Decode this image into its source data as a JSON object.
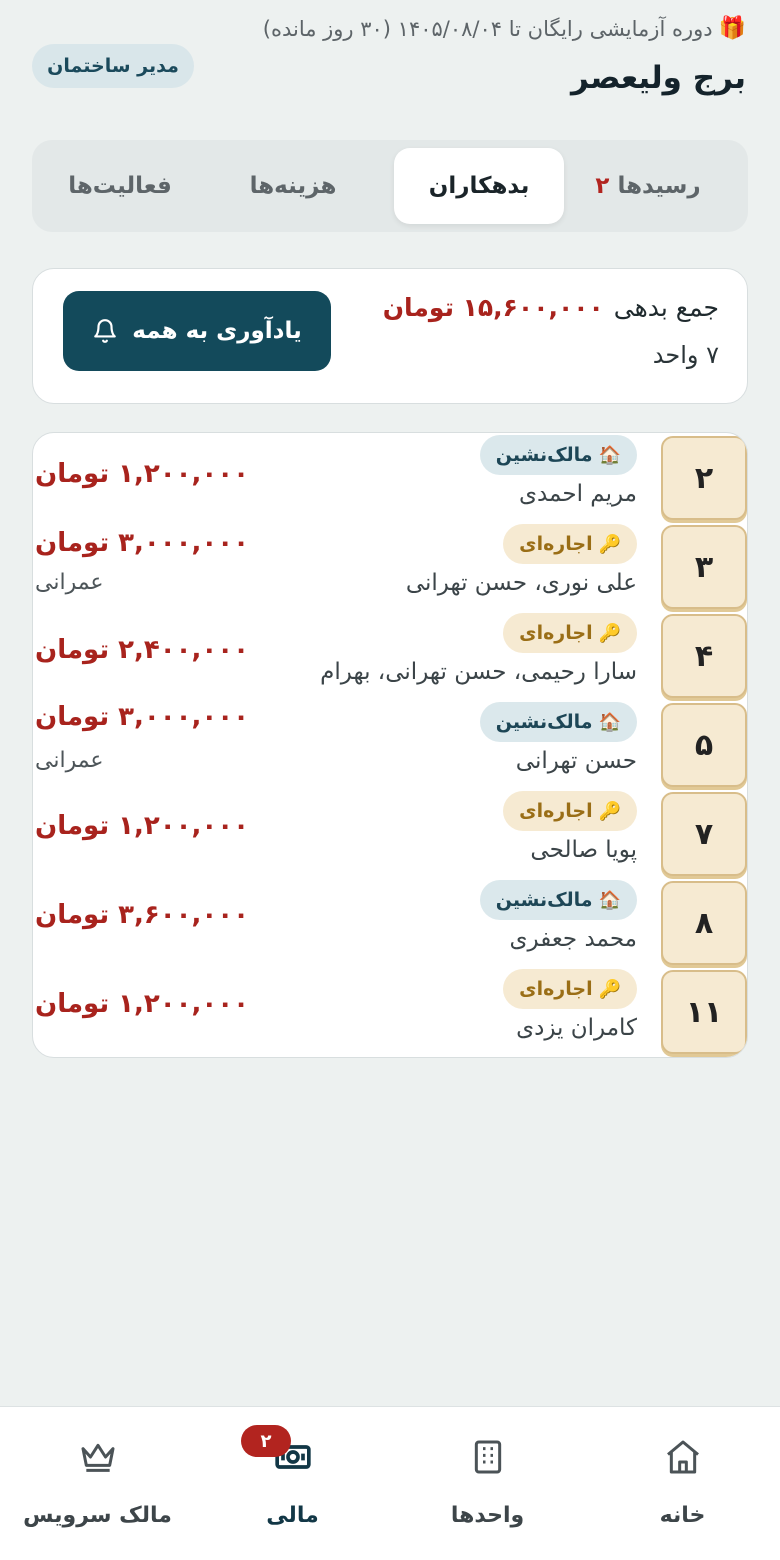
{
  "header": {
    "trial_text": "دوره آزمایشی رایگان تا ۱۴۰۵/۰۸/۰۴ (۳۰ روز مانده)",
    "building_name": "برج ولیعصر",
    "role": "مدیر ساختمان"
  },
  "tabs": [
    {
      "label": "رسیدها",
      "count": "۲"
    },
    {
      "label": "بدهکاران"
    },
    {
      "label": "هزینه‌ها"
    },
    {
      "label": "فعالیت‌ها"
    }
  ],
  "summary": {
    "label": "جمع بدهی",
    "amount": "۱۵,۶۰۰,۰۰۰ تومان",
    "units": "۷ واحد",
    "remind_button": "یادآوری به همه"
  },
  "debtors": [
    {
      "unit": "۲",
      "type": "مالک‌نشین",
      "names": "مریم احمدی",
      "extra": "",
      "amount": "۱,۲۰۰,۰۰۰ تومان"
    },
    {
      "unit": "۳",
      "type": "اجاره‌ای",
      "names": "علی نوری، حسن تهرانی",
      "extra": "عمرانی",
      "amount": "۳,۰۰۰,۰۰۰ تومان"
    },
    {
      "unit": "۴",
      "type": "اجاره‌ای",
      "names": "سارا رحیمی، حسن تهرانی، بهرام",
      "extra": "",
      "amount": "۲,۴۰۰,۰۰۰ تومان"
    },
    {
      "unit": "۵",
      "type": "مالک‌نشین",
      "names": "حسن تهرانی",
      "extra": "عمرانی",
      "amount": "۳,۰۰۰,۰۰۰ تومان"
    },
    {
      "unit": "۷",
      "type": "اجاره‌ای",
      "names": "پویا صالحی",
      "extra": "",
      "amount": "۱,۲۰۰,۰۰۰ تومان"
    },
    {
      "unit": "۸",
      "type": "مالک‌نشین",
      "names": "محمد جعفری",
      "extra": "",
      "amount": "۳,۶۰۰,۰۰۰ تومان"
    },
    {
      "unit": "۱۱",
      "type": "اجاره‌ای",
      "names": "کامران یزدی",
      "extra": "",
      "amount": "۱,۲۰۰,۰۰۰ تومان"
    }
  ],
  "nav": [
    {
      "label": "خانه",
      "icon": "home-icon"
    },
    {
      "label": "واحدها",
      "icon": "units-icon"
    },
    {
      "label": "مالی",
      "icon": "money-icon",
      "badge": "۲"
    },
    {
      "label": "مالک سرویس",
      "icon": "crown-icon"
    }
  ],
  "colors": {
    "primary": "#134a5b",
    "debt_red": "#a8231d",
    "background": "#edf1f0",
    "unit_box": "#f6ead2"
  }
}
